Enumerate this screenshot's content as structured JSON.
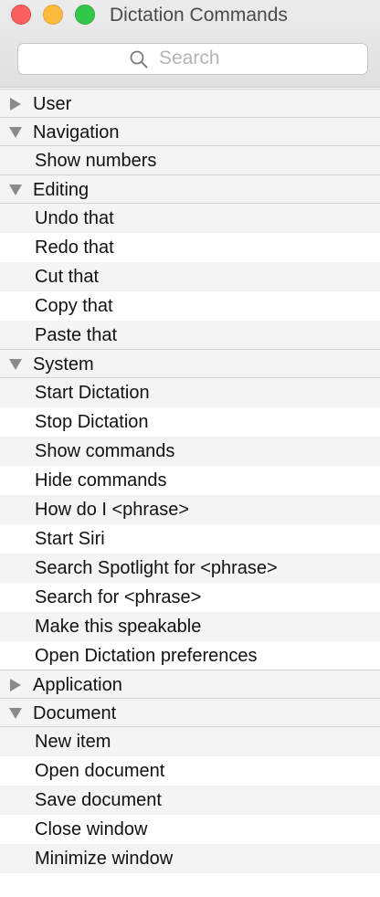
{
  "window": {
    "title": "Dictation Commands",
    "buttons": [
      "close",
      "minimize",
      "zoom"
    ]
  },
  "search": {
    "placeholder": "Search",
    "icon": "magnifying-glass-icon"
  },
  "list": {
    "groups": [
      {
        "label": "User",
        "expanded": false,
        "items": []
      },
      {
        "label": "Navigation",
        "expanded": true,
        "items": [
          "Show numbers"
        ]
      },
      {
        "label": "Editing",
        "expanded": true,
        "items": [
          "Undo that",
          "Redo that",
          "Cut that",
          "Copy that",
          "Paste that"
        ]
      },
      {
        "label": "System",
        "expanded": true,
        "items": [
          "Start Dictation",
          "Stop Dictation",
          "Show commands",
          "Hide commands",
          "How do I <phrase>",
          "Start Siri",
          "Search Spotlight for <phrase>",
          "Search for <phrase>",
          "Make this speakable",
          "Open Dictation preferences"
        ]
      },
      {
        "label": "Application",
        "expanded": false,
        "items": []
      },
      {
        "label": "Document",
        "expanded": true,
        "items": [
          "New item",
          "Open document",
          "Save document",
          "Close window",
          "Minimize window"
        ]
      }
    ]
  },
  "colors": {
    "close": "#fc605c",
    "minimize": "#fdbc40",
    "zoom": "#34c84a",
    "row_alt": "#f4f4f4",
    "disclosure": "#8a8a8a"
  }
}
